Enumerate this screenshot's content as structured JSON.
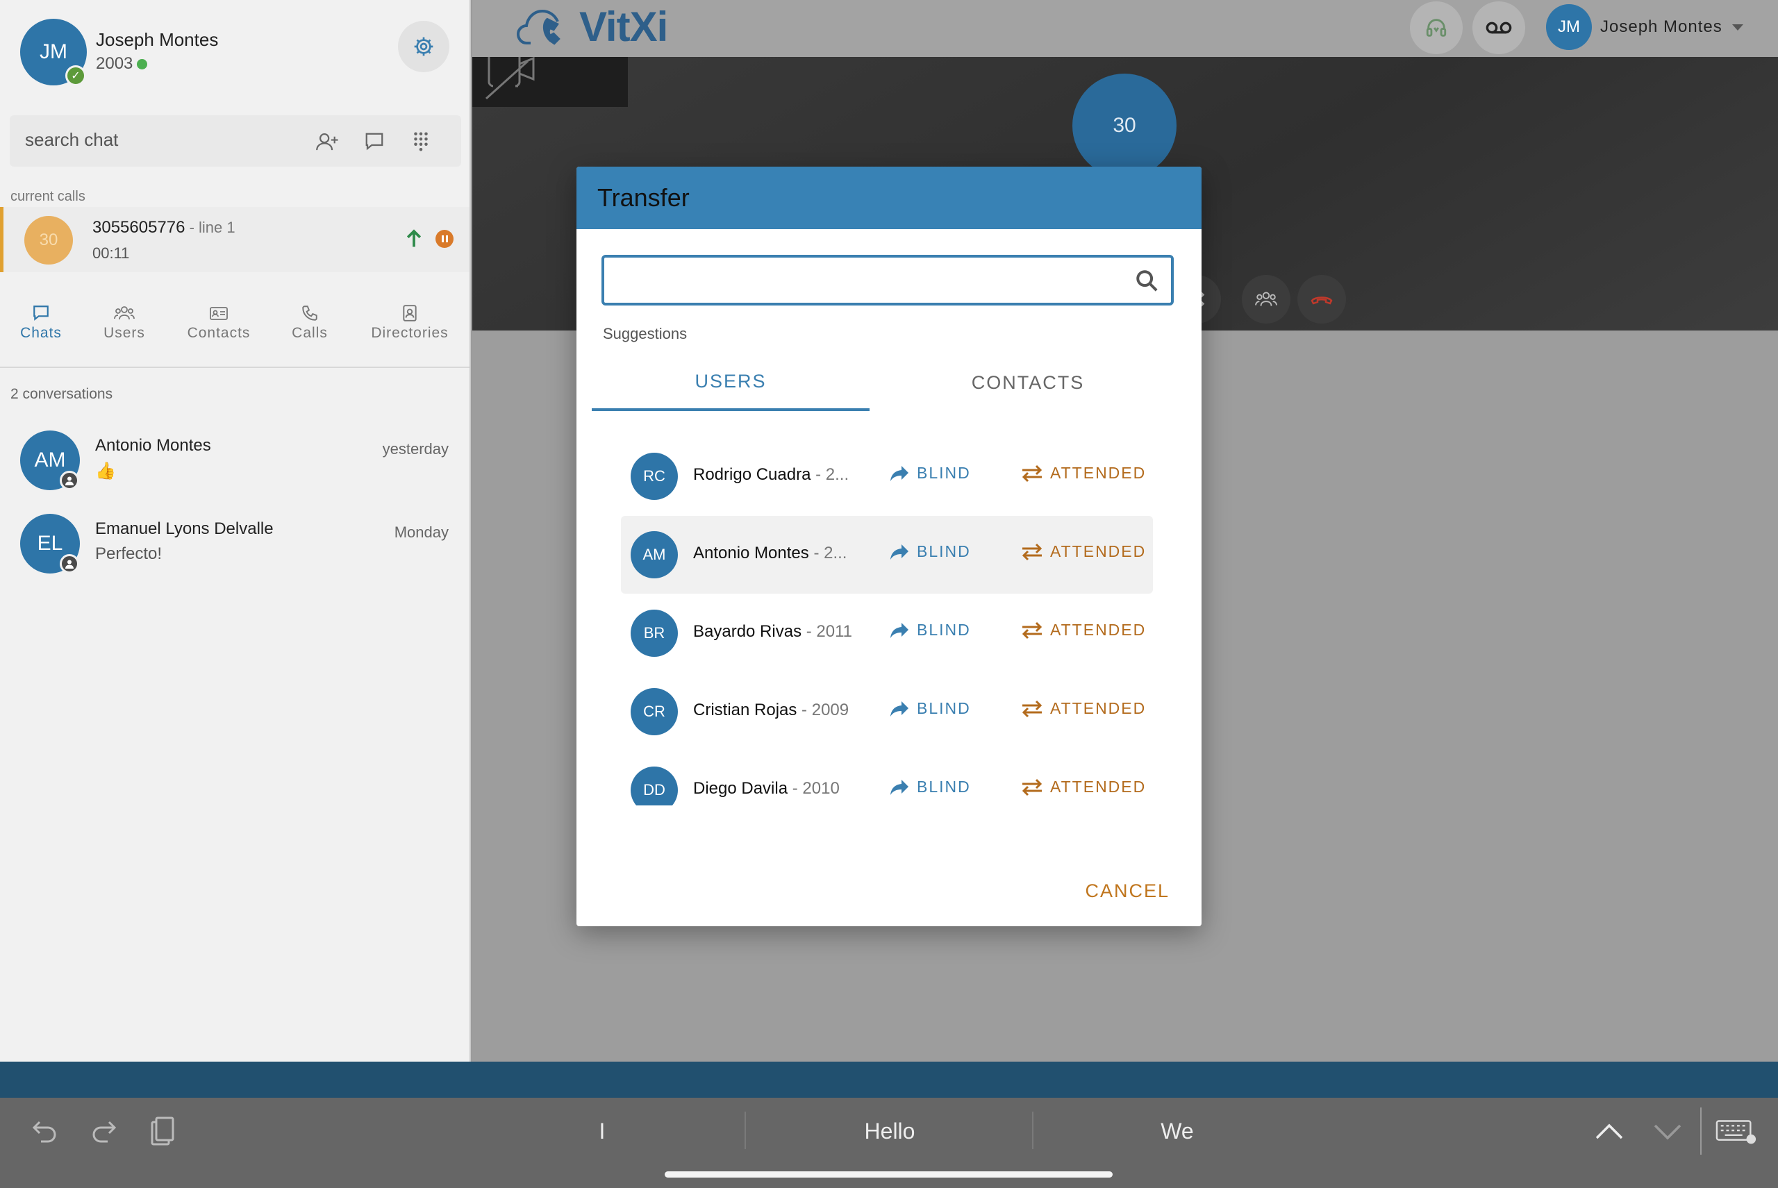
{
  "sidebar": {
    "me": {
      "initials": "JM",
      "name": "Joseph Montes",
      "extension": "2003"
    },
    "search": {
      "placeholder": "search chat"
    },
    "current_calls_label": "current calls",
    "call": {
      "avatar_text": "30",
      "number": "3055605776",
      "line": " - line 1",
      "timer": "00:11"
    },
    "tabs": [
      {
        "label": "Chats",
        "icon": "chat-icon",
        "active": true
      },
      {
        "label": "Users",
        "icon": "users-icon"
      },
      {
        "label": "Contacts",
        "icon": "contact-card-icon"
      },
      {
        "label": "Calls",
        "icon": "phone-icon"
      },
      {
        "label": "Directories",
        "icon": "directory-icon"
      }
    ],
    "conversation_count": "2 conversations",
    "conversations": [
      {
        "initials": "AM",
        "name": "Antonio Montes",
        "message": "👍",
        "time": "yesterday"
      },
      {
        "initials": "EL",
        "name": "Emanuel Lyons Delvalle",
        "message": "Perfecto!",
        "time": "Monday"
      }
    ]
  },
  "topbar": {
    "logo_text": "VitXi",
    "user_initials": "JM",
    "user_name": "Joseph Montes",
    "icons": [
      "headset-icon",
      "voicemail-icon",
      "chevron-down-icon"
    ]
  },
  "video": {
    "remote_avatar_text": "30"
  },
  "modal": {
    "title": "Transfer",
    "search_value": "",
    "suggestions_label": "Suggestions",
    "tabs": [
      "USERS",
      "CONTACTS"
    ],
    "active_tab": "USERS",
    "blind_label": "BLIND",
    "attended_label": "ATTENDED",
    "users": [
      {
        "initials": "RC",
        "name": "Rodrigo Cuadra",
        "ext": " - 2..."
      },
      {
        "initials": "AM",
        "name": "Antonio Montes",
        "ext": " - 2...",
        "highlighted": true
      },
      {
        "initials": "BR",
        "name": "Bayardo Rivas",
        "ext": " - 2011"
      },
      {
        "initials": "CR",
        "name": "Cristian Rojas",
        "ext": " - 2009"
      },
      {
        "initials": "DD",
        "name": "Diego Davila",
        "ext": " - 2010"
      }
    ],
    "cancel_label": "CANCEL"
  },
  "keyboard": {
    "suggestions": [
      "I",
      "Hello",
      "We"
    ]
  },
  "colors": {
    "brand_blue": "#3882b5",
    "attended_orange": "#b36b1d",
    "cancel_orange": "#c0761e",
    "status_green": "#4caf50"
  }
}
